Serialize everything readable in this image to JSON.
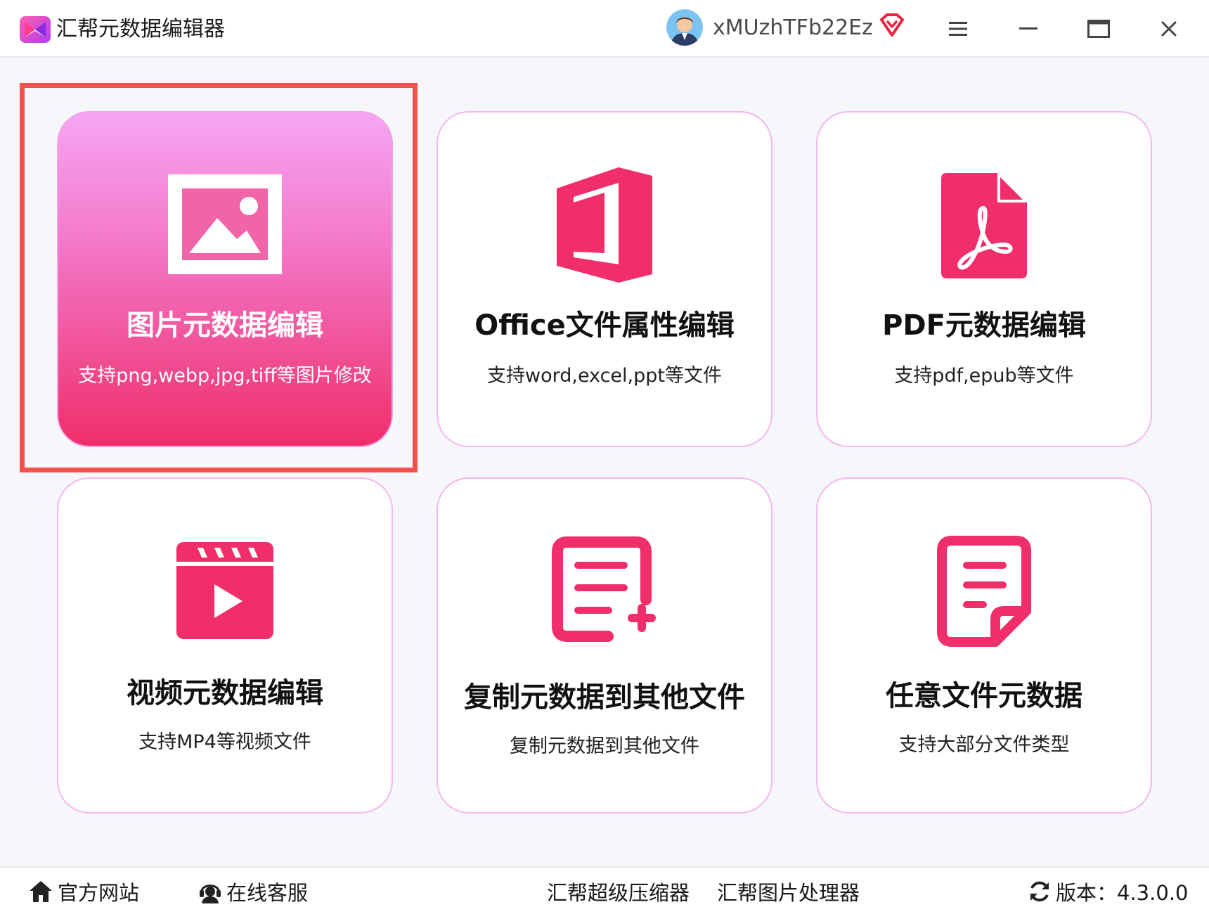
{
  "app": {
    "title": "汇帮元数据编辑器",
    "username": "xMUzhTFb22Ez"
  },
  "colors": {
    "accent": "#ef2e6a",
    "card_border": "#f3b7ee",
    "highlight": "#f2524e"
  },
  "icons": {
    "logo": "app-logo-icon",
    "vip": "vip-diamond-icon",
    "menu": "menu-icon",
    "minimize": "minimize-icon",
    "maximize": "maximize-icon",
    "close": "close-icon"
  },
  "cards": [
    {
      "title": "图片元数据编辑",
      "subtitle": "支持png,webp,jpg,tiff等图片修改",
      "icon": "image-icon",
      "selected": true
    },
    {
      "title": "Office文件属性编辑",
      "subtitle": "支持word,excel,ppt等文件",
      "icon": "office-icon",
      "selected": false
    },
    {
      "title": "PDF元数据编辑",
      "subtitle": "支持pdf,epub等文件",
      "icon": "pdf-icon",
      "selected": false
    },
    {
      "title": "视频元数据编辑",
      "subtitle": "支持MP4等视频文件",
      "icon": "video-icon",
      "selected": false
    },
    {
      "title": "复制元数据到其他文件",
      "subtitle": "复制元数据到其他文件",
      "icon": "copy-document-icon",
      "selected": false
    },
    {
      "title": "任意文件元数据",
      "subtitle": "支持大部分文件类型",
      "icon": "file-icon",
      "selected": false
    }
  ],
  "footer": {
    "website": "官方网站",
    "support": "在线客服",
    "compressor": "汇帮超级压缩器",
    "image_processor": "汇帮图片处理器",
    "version": "版本：4.3.0.0"
  }
}
